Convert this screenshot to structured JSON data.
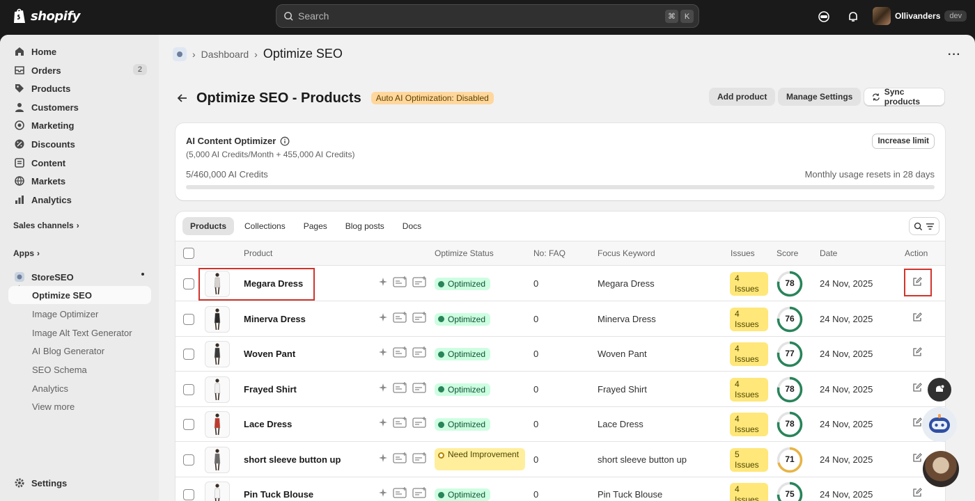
{
  "topbar": {
    "logo_text": "shopify",
    "search_placeholder": "Search",
    "shortcut_cmd": "⌘",
    "shortcut_key": "K",
    "store_name": "Ollivanders",
    "store_badge": "dev"
  },
  "sidebar": {
    "items": [
      {
        "label": "Home",
        "icon": "home-icon"
      },
      {
        "label": "Orders",
        "icon": "orders-icon",
        "badge": "2"
      },
      {
        "label": "Products",
        "icon": "tag-icon"
      },
      {
        "label": "Customers",
        "icon": "person-icon"
      },
      {
        "label": "Marketing",
        "icon": "target-icon"
      },
      {
        "label": "Discounts",
        "icon": "discount-icon"
      },
      {
        "label": "Content",
        "icon": "content-icon"
      },
      {
        "label": "Markets",
        "icon": "globe-icon"
      },
      {
        "label": "Analytics",
        "icon": "bar-chart-icon"
      }
    ],
    "sales_channels_label": "Sales channels",
    "apps_label": "Apps",
    "app_name": "StoreSEO",
    "app_sub_items": [
      "Optimize SEO",
      "Image Optimizer",
      "Image Alt Text Generator",
      "AI Blog Generator",
      "SEO Schema",
      "Analytics",
      "View more"
    ],
    "settings_label": "Settings"
  },
  "breadcrumb": {
    "parent": "Dashboard",
    "current": "Optimize SEO"
  },
  "page": {
    "title": "Optimize SEO - Products",
    "auto_badge": "Auto AI Optimization: Disabled",
    "add_product": "Add product",
    "manage_settings": "Manage Settings",
    "sync_products": "Sync products"
  },
  "credits": {
    "title": "AI Content Optimizer",
    "subtitle": "(5,000 AI Credits/Month + 455,000 AI Credits)",
    "used_text": "5/460,000 AI Credits",
    "reset_text": "Monthly usage resets in 28 days",
    "increase_button": "Increase limit",
    "used_fraction": 1.09e-05
  },
  "tabs": [
    "Products",
    "Collections",
    "Pages",
    "Blog posts",
    "Docs"
  ],
  "columns": {
    "product": "Product",
    "status": "Optimize Status",
    "faq": "No: FAQ",
    "keyword": "Focus Keyword",
    "issues": "Issues",
    "score": "Score",
    "date": "Date",
    "action": "Action"
  },
  "rows": [
    {
      "name": "Megara Dress",
      "status": "Optimized",
      "faq": "0",
      "keyword": "Megara Dress",
      "issues_count": "4",
      "issues_word": "Issues",
      "score": 78,
      "date": "24 Nov, 2025"
    },
    {
      "name": "Minerva Dress",
      "status": "Optimized",
      "faq": "0",
      "keyword": "Minerva Dress",
      "issues_count": "4",
      "issues_word": "Issues",
      "score": 76,
      "date": "24 Nov, 2025"
    },
    {
      "name": "Woven Pant",
      "status": "Optimized",
      "faq": "0",
      "keyword": "Woven Pant",
      "issues_count": "4",
      "issues_word": "Issues",
      "score": 77,
      "date": "24 Nov, 2025"
    },
    {
      "name": "Frayed Shirt",
      "status": "Optimized",
      "faq": "0",
      "keyword": "Frayed Shirt",
      "issues_count": "4",
      "issues_word": "Issues",
      "score": 78,
      "date": "24 Nov, 2025"
    },
    {
      "name": "Lace Dress",
      "status": "Optimized",
      "faq": "0",
      "keyword": "Lace Dress",
      "issues_count": "4",
      "issues_word": "Issues",
      "score": 78,
      "date": "24 Nov, 2025"
    },
    {
      "name": "short sleeve button up",
      "status": "Need Improvement",
      "faq": "0",
      "keyword": "short sleeve button up",
      "issues_count": "5",
      "issues_word": "Issues",
      "score": 71,
      "date": "24 Nov, 2025"
    },
    {
      "name": "Pin Tuck Blouse",
      "status": "Optimized",
      "faq": "0",
      "keyword": "Pin Tuck Blouse",
      "issues_count": "4",
      "issues_word": "Issues",
      "score": 75,
      "date": "24 Nov, 2025"
    }
  ],
  "colors": {
    "score_good": "#29845a",
    "score_warn": "#e8b445",
    "highlight": "#d0342c"
  }
}
